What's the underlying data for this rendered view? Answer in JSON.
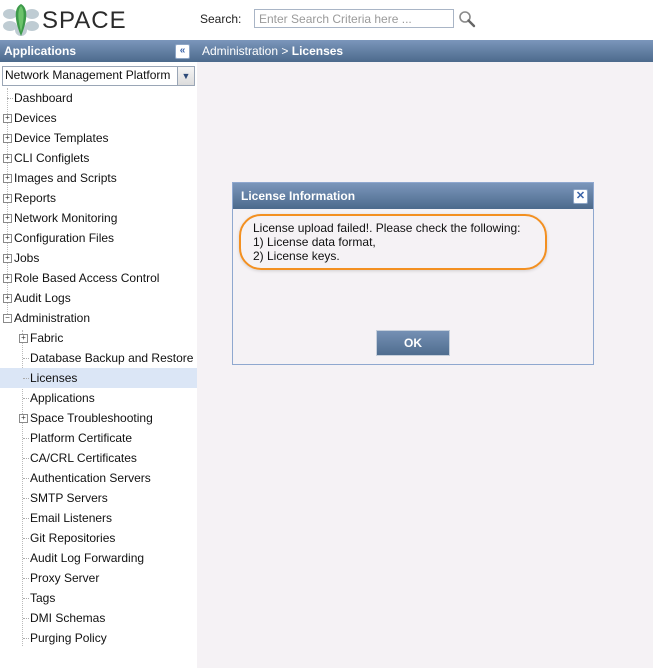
{
  "app": {
    "brand": "SPACE",
    "logo_icon": "space-flower-logo",
    "accent_color": "#4c6a8c",
    "highlight_color": "#f39021"
  },
  "search": {
    "label": "Search:",
    "placeholder": "Enter Search Criteria here ...",
    "value": "",
    "icon": "magnifier-icon"
  },
  "sidebar": {
    "title": "Applications",
    "collapse_icon": "double-chevron-left-icon",
    "selected_app": "Network Management Platform",
    "items": [
      {
        "label": "Dashboard",
        "level": 0,
        "expander": "none"
      },
      {
        "label": "Devices",
        "level": 0,
        "expander": "plus"
      },
      {
        "label": "Device Templates",
        "level": 0,
        "expander": "plus"
      },
      {
        "label": "CLI Configlets",
        "level": 0,
        "expander": "plus"
      },
      {
        "label": "Images and Scripts",
        "level": 0,
        "expander": "plus"
      },
      {
        "label": "Reports",
        "level": 0,
        "expander": "plus"
      },
      {
        "label": "Network Monitoring",
        "level": 0,
        "expander": "plus"
      },
      {
        "label": "Configuration Files",
        "level": 0,
        "expander": "plus"
      },
      {
        "label": "Jobs",
        "level": 0,
        "expander": "plus"
      },
      {
        "label": "Role Based Access Control",
        "level": 0,
        "expander": "plus"
      },
      {
        "label": "Audit Logs",
        "level": 0,
        "expander": "plus"
      },
      {
        "label": "Administration",
        "level": 0,
        "expander": "minus"
      },
      {
        "label": "Fabric",
        "level": 1,
        "expander": "plus"
      },
      {
        "label": "Database Backup and Restore",
        "level": 1,
        "expander": "none"
      },
      {
        "label": "Licenses",
        "level": 1,
        "expander": "none",
        "selected": true
      },
      {
        "label": "Applications",
        "level": 1,
        "expander": "none"
      },
      {
        "label": "Space Troubleshooting",
        "level": 1,
        "expander": "plus"
      },
      {
        "label": "Platform Certificate",
        "level": 1,
        "expander": "none"
      },
      {
        "label": "CA/CRL Certificates",
        "level": 1,
        "expander": "none"
      },
      {
        "label": "Authentication Servers",
        "level": 1,
        "expander": "none"
      },
      {
        "label": "SMTP Servers",
        "level": 1,
        "expander": "none"
      },
      {
        "label": "Email Listeners",
        "level": 1,
        "expander": "none"
      },
      {
        "label": "Git Repositories",
        "level": 1,
        "expander": "none"
      },
      {
        "label": "Audit Log Forwarding",
        "level": 1,
        "expander": "none"
      },
      {
        "label": "Proxy Server",
        "level": 1,
        "expander": "none"
      },
      {
        "label": "Tags",
        "level": 1,
        "expander": "none"
      },
      {
        "label": "DMI Schemas",
        "level": 1,
        "expander": "none"
      },
      {
        "label": "Purging Policy",
        "level": 1,
        "expander": "none"
      }
    ]
  },
  "breadcrumb": {
    "parent": "Administration",
    "separator": ">",
    "current": "Licenses"
  },
  "dialog": {
    "title": "License Information",
    "close_icon": "close-x-icon",
    "lines": [
      "License upload failed!. Please check the following:",
      "1) License data format,",
      "2) License keys."
    ],
    "ok_label": "OK"
  }
}
